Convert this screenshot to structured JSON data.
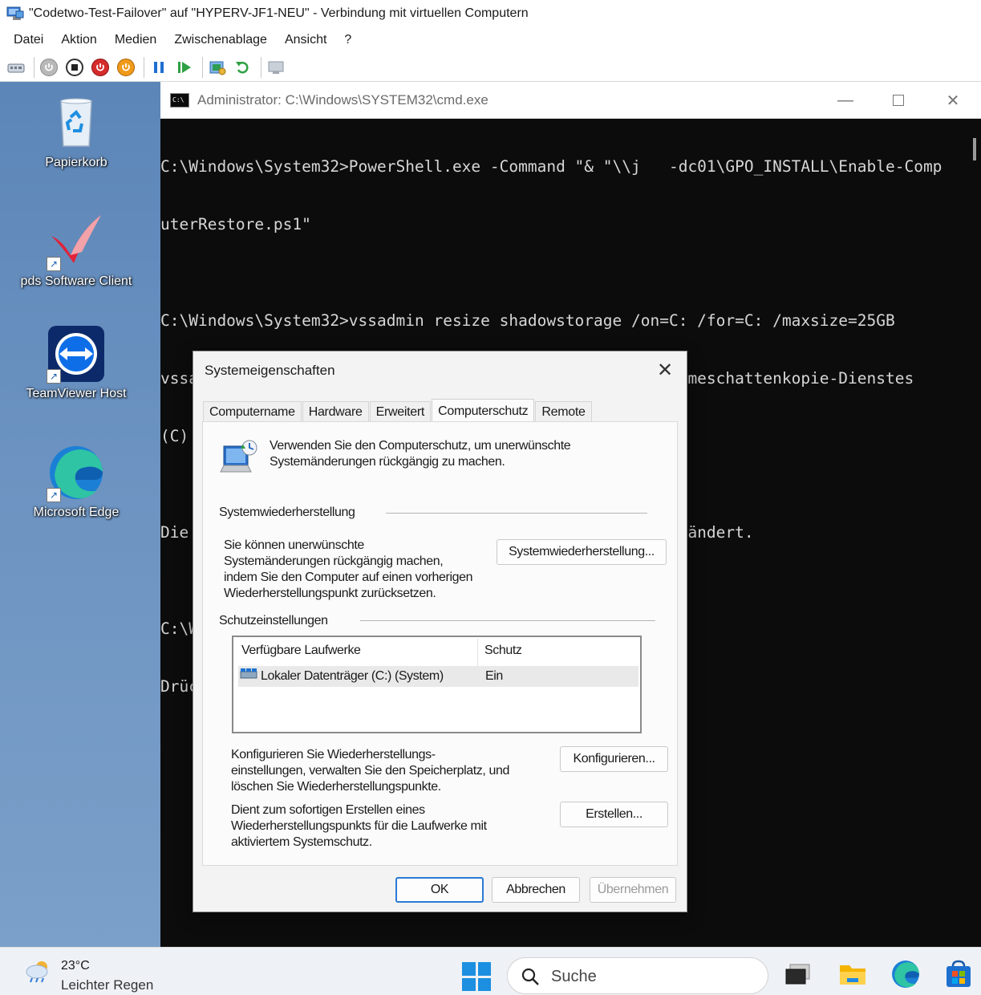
{
  "host_window": {
    "title": "\"Codetwo-Test-Failover\" auf \"HYPERV-JF1-NEU\" - Verbindung mit virtuellen Computern",
    "menu": [
      "Datei",
      "Aktion",
      "Medien",
      "Zwischenablage",
      "Ansicht",
      "?"
    ],
    "toolbar_icons": [
      "ctrl-alt-del-icon",
      "start-icon",
      "turn-off-icon",
      "shutdown-icon",
      "save-icon",
      "pause-icon",
      "resume-icon",
      "checkpoint-icon",
      "revert-icon",
      "enhanced-session-icon"
    ]
  },
  "desktop": {
    "icons": [
      {
        "label": "Papierkorb",
        "icon": "recycle-bin-icon"
      },
      {
        "label": "pds Software Client",
        "icon": "pds-client-icon"
      },
      {
        "label": "TeamViewer Host",
        "icon": "teamviewer-icon"
      },
      {
        "label": "Microsoft Edge",
        "icon": "edge-icon"
      }
    ]
  },
  "cmd": {
    "title": "Administrator: C:\\Windows\\SYSTEM32\\cmd.exe",
    "lines": [
      "C:\\Windows\\System32>PowerShell.exe -Command \"& \"\\\\j   -dc01\\GPO_INSTALL\\Enable-Comp",
      "uterRestore.ps1\"",
      "",
      "C:\\Windows\\System32>vssadmin resize shadowstorage /on=C: /for=C: /maxsize=25GB",
      "vssadmin 1.1 - Verwaltungsbefehlszeilenprogramm des Volumeschattenkopie-Dienstes",
      "(C) Copyright 2001-2013 Microsoft Corp.",
      "",
      "Die Größe der Schattenkopie-Speicherassoziation wurde geändert.",
      "",
      "C:\\Windows\\System32>Pause",
      "Drücken Sie eine beliebige Taste . . ."
    ]
  },
  "dialog": {
    "title": "Systemeigenschaften",
    "tabs": [
      "Computername",
      "Hardware",
      "Erweitert",
      "Computerschutz",
      "Remote"
    ],
    "active_tab": "Computerschutz",
    "intro": [
      "Verwenden Sie den Computerschutz, um unerwünschte",
      "Systemänderungen rückgängig zu machen."
    ],
    "restore_group": {
      "heading": "Systemwiederherstellung",
      "text": [
        "Sie können unerwünschte",
        "Systemänderungen rückgängig machen,",
        "indem Sie den Computer auf einen vorherigen",
        "Wiederherstellungspunkt zurücksetzen."
      ],
      "button": "Systemwiederherstellung..."
    },
    "protection_group": {
      "heading": "Schutzeinstellungen",
      "columns": [
        "Verfügbare Laufwerke",
        "Schutz"
      ],
      "rows": [
        {
          "drive": "Lokaler Datenträger (C:) (System)",
          "protection": "Ein"
        }
      ],
      "configure_text": [
        "Konfigurieren Sie Wiederherstellungs-",
        "einstellungen, verwalten Sie den Speicherplatz, und",
        "löschen Sie Wiederherstellungspunkte."
      ],
      "configure_button": "Konfigurieren...",
      "create_text": [
        "Dient zum sofortigen Erstellen eines",
        "Wiederherstellungspunkts für die Laufwerke mit",
        "aktiviertem Systemschutz."
      ],
      "create_button": "Erstellen..."
    },
    "buttons": {
      "ok": "OK",
      "cancel": "Abbrechen",
      "apply": "Übernehmen"
    }
  },
  "taskbar": {
    "weather_temp": "23°C",
    "weather_desc": "Leichter Regen",
    "search_placeholder": "Suche",
    "apps": [
      "task-view-icon",
      "file-explorer-icon",
      "edge-icon",
      "store-icon"
    ]
  }
}
